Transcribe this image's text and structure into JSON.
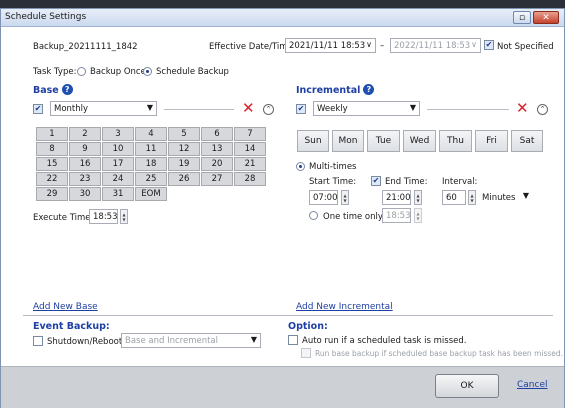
{
  "window": {
    "title": "Schedule Settings"
  },
  "header": {
    "job_name": "Backup_20211111_1842",
    "effective_label": "Effective Date/Time:",
    "start_value": "2021/11/11 18:53",
    "dash": "–",
    "end_value": "2022/11/11 18:53",
    "not_specified_label": "Not Specified"
  },
  "task_type": {
    "label": "Task Type:",
    "option1": "Backup Once",
    "option2": "Schedule Backup"
  },
  "base": {
    "title": "Base",
    "frequency": "Monthly",
    "calendar": [
      "1",
      "2",
      "3",
      "4",
      "5",
      "6",
      "7",
      "8",
      "9",
      "10",
      "11",
      "12",
      "13",
      "14",
      "15",
      "16",
      "17",
      "18",
      "19",
      "20",
      "21",
      "22",
      "23",
      "24",
      "25",
      "26",
      "27",
      "28",
      "29",
      "30",
      "31",
      "EOM"
    ],
    "execute_label": "Execute Time:",
    "execute_value": "18:53",
    "add_link": "Add New Base"
  },
  "incremental": {
    "title": "Incremental",
    "frequency": "Weekly",
    "days": [
      "Sun",
      "Mon",
      "Tue",
      "Wed",
      "Thu",
      "Fri",
      "Sat"
    ],
    "multi_label": "Multi-times",
    "start_label": "Start Time:",
    "end_label": "End Time:",
    "interval_label": "Interval:",
    "start_value": "07:00",
    "end_value": "21:00",
    "interval_value": "60",
    "interval_unit": "Minutes",
    "one_time_label": "One time only:",
    "one_time_value": "18:53",
    "add_link": "Add New Incremental"
  },
  "event": {
    "title": "Event Backup:",
    "shutdown_label": "Shutdown/Reboot",
    "mode_value": "Base and Incremental"
  },
  "option": {
    "title": "Option:",
    "auto_run_label": "Auto run if a scheduled task is missed.",
    "run_base_label": "Run base backup if scheduled base backup task has been missed."
  },
  "footer": {
    "ok": "OK",
    "cancel": "Cancel"
  },
  "icons": {
    "check": "✔",
    "arrow": "▼",
    "remove": "✕",
    "collapse": "⌃",
    "close": "✕",
    "minimize": "▫"
  }
}
